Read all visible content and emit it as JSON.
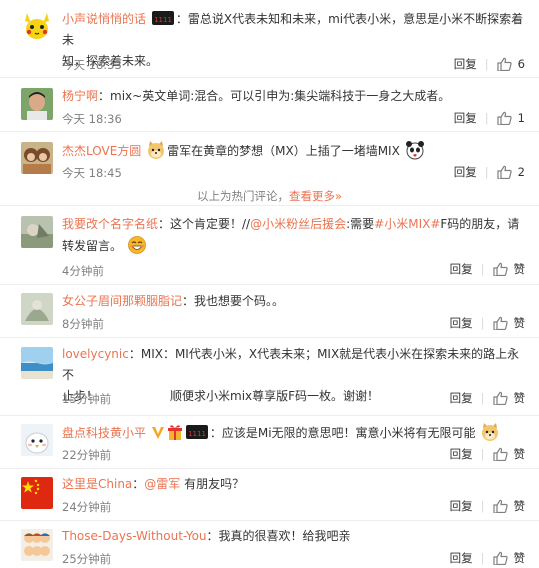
{
  "hot_comments": [
    {
      "nick": "小声说悄悄的话",
      "text_1": "：雷总说X代表未知和未来，mi代表小米，意思是小米不断探索着未",
      "text_2": "知，探索着未来。",
      "time": "今天 18:33",
      "reply": "回复",
      "likes": "6",
      "badge_icon": "cat-1111-icon"
    },
    {
      "nick": "杨宁啊",
      "text_1": "：mix~英文单词:混合。可以引申为:集尖端科技于一身之大成者。",
      "time": "今天 18:36",
      "reply": "回复",
      "likes": "1"
    },
    {
      "nick": "杰杰LOVE方圆",
      "text_1": "雷军在黄章的梦想（MX）上插了一堵墙MIX",
      "time": "今天 18:45",
      "reply": "回复",
      "likes": "2"
    }
  ],
  "divider": {
    "text": "以上为热门评论，",
    "more": "查看更多»"
  },
  "comments": [
    {
      "nick": "我要改个名字名纸",
      "text_a": "：这个肯定要！//",
      "at": "@小米粉丝后援会",
      "text_b": ":需要",
      "tag": "#小米MIX#",
      "text_c": "F码的朋友，请",
      "text_2": "转发留言。",
      "time": "4分钟前",
      "reply": "回复",
      "likes": "赞"
    },
    {
      "nick": "女公子眉间那颗胭脂记",
      "text_1": "：我也想要个码。。",
      "time": "8分钟前",
      "reply": "回复",
      "likes": "赞"
    },
    {
      "nick": "lovelycynic",
      "text_1": "：MIX：MI代表小米，X代表未来；MIX就是代表小米在探索未来的路上永不",
      "text_2": "止步！　　　　　　顺便求小米mix尊享版F码一枚。谢谢！",
      "time": "15分钟前",
      "reply": "回复",
      "likes": "赞"
    },
    {
      "nick": "盘点科技黄小平",
      "text_1": "：应该是Mi无限的意思吧！寓意小米将有无限可能",
      "time": "22分钟前",
      "reply": "回复",
      "likes": "赞"
    },
    {
      "nick": "这里是China",
      "text_1": "：",
      "at": "@雷军",
      "text_b": " 有朋友吗？",
      "time": "24分钟前",
      "reply": "回复",
      "likes": "赞"
    },
    {
      "nick": "Those-Days-Without-You",
      "text_1": "：我真的很喜欢！给我吧亲",
      "time": "25分钟前",
      "reply": "回复",
      "likes": "赞"
    }
  ],
  "colors": {
    "accent": "#eb7350",
    "meta": "#808080",
    "text": "#333333"
  }
}
